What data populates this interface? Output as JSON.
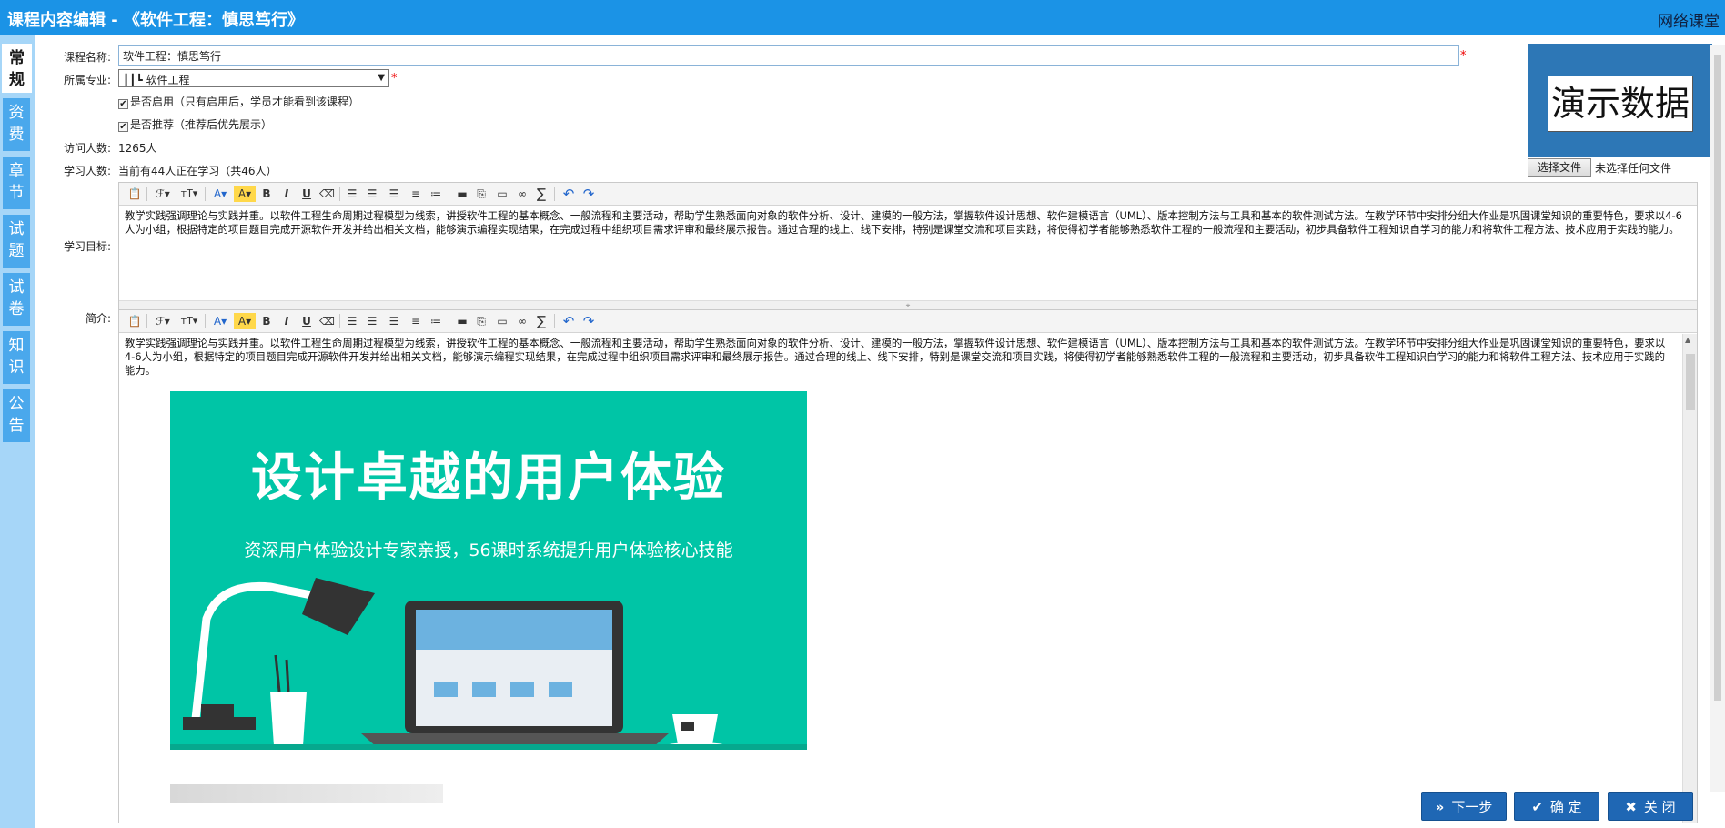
{
  "header": {
    "title": "课程内容编辑 - 《软件工程：慎思笃行》",
    "brand": "网络课堂"
  },
  "sidebar": {
    "tabs": [
      {
        "label": "常规",
        "active": true
      },
      {
        "label": "资费"
      },
      {
        "label": "章节"
      },
      {
        "label": "试题"
      },
      {
        "label": "试卷"
      },
      {
        "label": "知识"
      },
      {
        "label": "公告"
      }
    ]
  },
  "form": {
    "course_name_label": "课程名称:",
    "course_name_value": "软件工程：慎思笃行",
    "required_mark": "*",
    "major_label": "所属专业:",
    "major_value": "┃┃┗ 软件工程",
    "enabled_label": "是否启用（只有启用后，学员才能看到该课程）",
    "enabled_checked": "✔",
    "recommend_label": "是否推荐（推荐后优先展示）",
    "recommend_checked": "✔",
    "visitors_label": "访问人数:",
    "visitors_value": "1265人",
    "learners_label": "学习人数:",
    "learners_value": "当前有44人正在学习（共46人）",
    "goal_label": "学习目标:",
    "intro_label": "简介:"
  },
  "preview": {
    "image_text": "演示数据",
    "choose_file_button": "选择文件",
    "file_status": "未选择任何文件"
  },
  "toolbar": {
    "font_family": "ℱ▾",
    "font_size": "тT▾",
    "font_color": "A▾",
    "highlight": "A▾",
    "bold": "B",
    "italic": "I",
    "underline": "U",
    "sum": "∑",
    "undo": "↶",
    "redo": "↷"
  },
  "editors": {
    "goal_text": "教学实践强调理论与实践并重。以软件工程生命周期过程模型为线索，讲授软件工程的基本概念、一般流程和主要活动，帮助学生熟悉面向对象的软件分析、设计、建模的一般方法，掌握软件设计思想、软件建模语言（UML）、版本控制方法与工具和基本的软件测试方法。在教学环节中安排分组大作业是巩固课堂知识的重要特色，要求以4-6人为小组，根据特定的项目题目完成开源软件开发并给出相关文档，能够演示编程实现结果，在完成过程中组织项目需求评审和最终展示报告。通过合理的线上、线下安排，特别是课堂交流和项目实践，将使得初学者能够熟悉软件工程的一般流程和主要活动，初步具备软件工程知识自学习的能力和将软件工程方法、技术应用于实践的能力。",
    "intro_text": "教学实践强调理论与实践并重。以软件工程生命周期过程模型为线索，讲授软件工程的基本概念、一般流程和主要活动，帮助学生熟悉面向对象的软件分析、设计、建模的一般方法，掌握软件设计思想、软件建模语言（UML）、版本控制方法与工具和基本的软件测试方法。在教学环节中安排分组大作业是巩固课堂知识的重要特色，要求以4-6人为小组，根据特定的项目题目完成开源软件开发并给出相关文档，能够演示编程实现结果，在完成过程中组织项目需求评审和最终展示报告。通过合理的线上、线下安排，特别是课堂交流和项目实践，将使得初学者能够熟悉软件工程的一般流程和主要活动，初步具备软件工程知识自学习的能力和将软件工程方法、技术应用于实践的能力。",
    "banner_title": "设计卓越的用户体验",
    "banner_subtitle": "资深用户体验设计专家亲授，56课时系统提升用户体验核心技能"
  },
  "footer": {
    "next_button": "下一步",
    "confirm_button": "确 定",
    "close_button": "关 闭"
  },
  "colors": {
    "header_bg": "#1b93e6",
    "sidebar_bg": "#a6d6f8",
    "tab_bg": "#4aa8ec",
    "banner_bg": "#00c5a6",
    "button_bg": "#1f67b4"
  }
}
